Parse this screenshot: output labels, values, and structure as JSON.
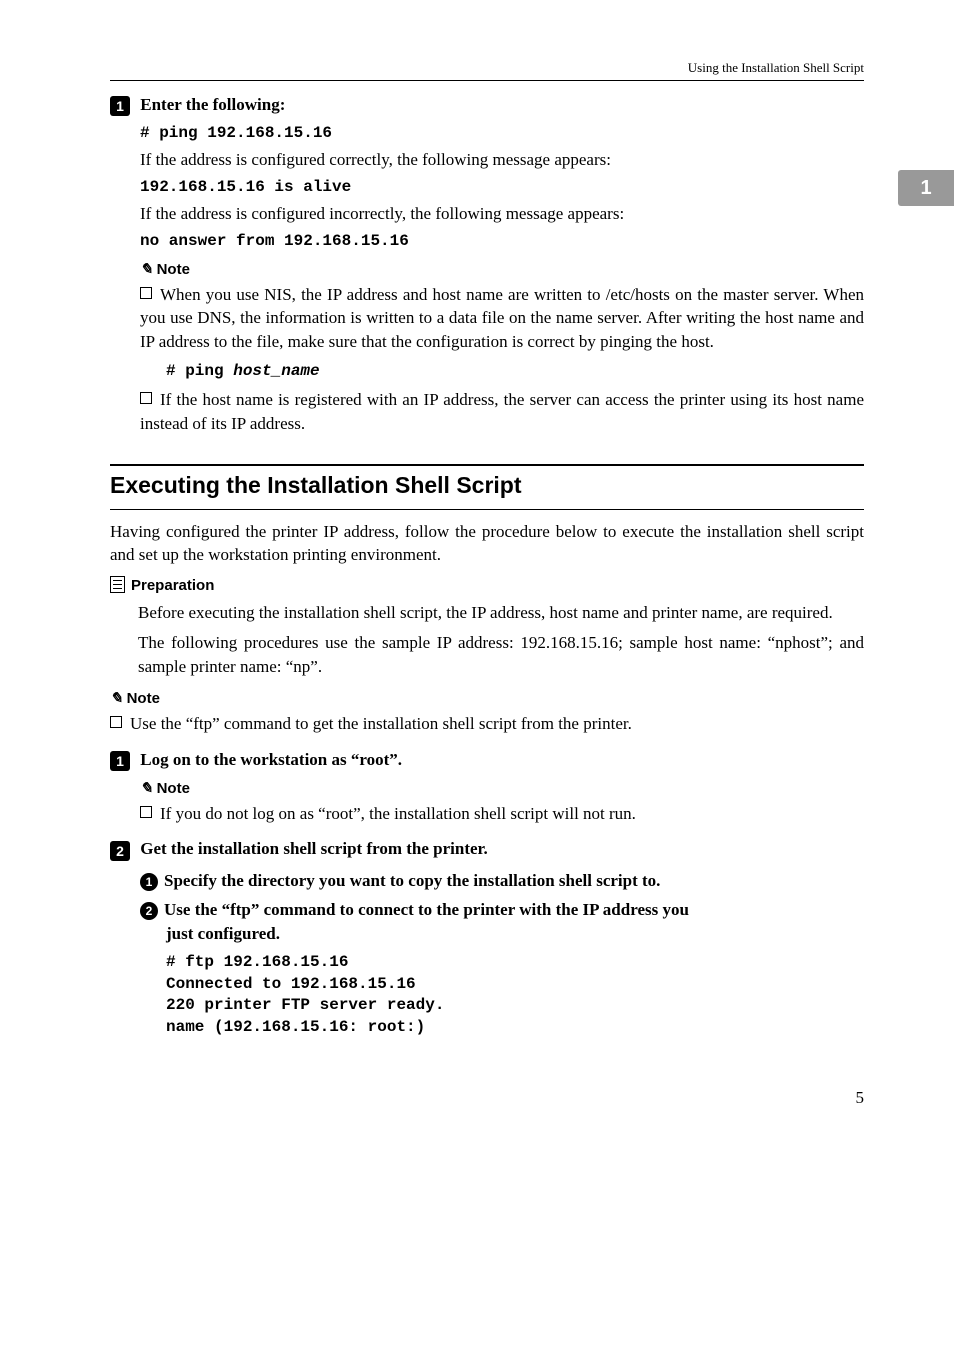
{
  "header": {
    "right": "Using the Installation Shell Script"
  },
  "sidetab": "1",
  "step1": {
    "num": "1",
    "text": "Enter the following:",
    "code1": "# ping 192.168.15.16",
    "body1": "If the address is configured correctly, the following message appears:",
    "code2": "192.168.15.16 is alive",
    "body2": "If the address is configured incorrectly, the following message appears:",
    "code3": "no answer from 192.168.15.16"
  },
  "note1": {
    "label": "Note",
    "b1": "When you use NIS, the IP address and host name are written to /etc/hosts on the master server. When you use DNS, the information is written to a data file on the name server. After writing the host name and IP address to the file, make sure that the configuration is correct by pinging the host.",
    "code_prefix": "# ping ",
    "code_var": "host_name",
    "b2": "If the host name is registered with an IP address, the server can access the printer using its host name instead of its IP address."
  },
  "h2": "Executing the Installation Shell Script",
  "intro": "Having configured the printer IP address, follow the procedure below to execute the installation shell script and set up the workstation printing environment.",
  "prep": {
    "label": "Preparation",
    "p1": "Before executing the installation shell script, the IP address, host name and printer name, are required.",
    "p2": "The following procedures use the sample IP address: 192.168.15.16; sample host name: “nphost”; and sample printer name: “np”."
  },
  "note2": {
    "label": "Note",
    "b1": "Use the “ftp” command to get the installation shell script from the printer."
  },
  "stepA": {
    "num": "1",
    "text": "Log on to the workstation as “root”.",
    "noteLabel": "Note",
    "noteB1": "If you do not log on as “root”, the installation shell script will not run."
  },
  "stepB": {
    "num": "2",
    "text": "Get the installation shell script from the printer.",
    "s1num": "1",
    "s1": "Specify the directory you want to copy the installation shell script to.",
    "s2num": "2",
    "s2a": "Use the “ftp” command to connect to the printer with the IP address you",
    "s2b": "just configured.",
    "code": "# ftp 192.168.15.16\nConnected to 192.168.15.16\n220 printer FTP server ready.\nname (192.168.15.16: root:)"
  },
  "pagenum": "5"
}
